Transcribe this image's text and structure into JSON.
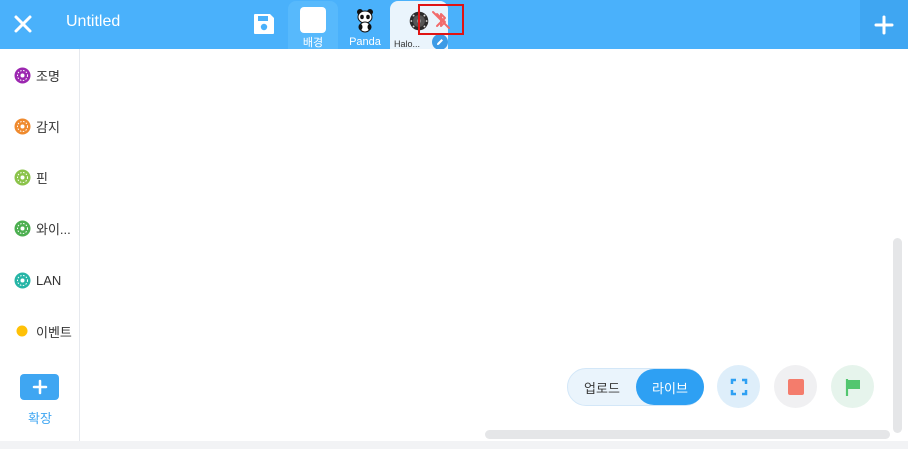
{
  "header": {
    "title": "Untitled",
    "tabs": [
      {
        "label": "배경"
      },
      {
        "label": "Panda"
      },
      {
        "label": "Halo..."
      }
    ]
  },
  "sidebar": {
    "categories": [
      {
        "label": "조명",
        "color": "#9c27b0"
      },
      {
        "label": "감지",
        "color": "#ef8a2e"
      },
      {
        "label": "핀",
        "color": "#8bc34a"
      },
      {
        "label": "와이...",
        "color": "#4caf50"
      },
      {
        "label": "LAN",
        "color": "#26b5a6"
      },
      {
        "label": "이벤트",
        "color": "#ffc107"
      }
    ],
    "extension_label": "확장"
  },
  "controls": {
    "upload_label": "업로드",
    "live_label": "라이브"
  },
  "colors": {
    "header": "#4ab1fb",
    "accent": "#2ea0f3",
    "bluetooth_off": "#f26b6b",
    "stop": "#f47c6c",
    "flag": "#52c66f",
    "highlight_box": "#e01313"
  },
  "icons": {
    "close": "close-icon",
    "save": "save-icon",
    "bluetooth": "bluetooth-disconnected-icon",
    "add": "plus-icon",
    "edit": "pencil-icon",
    "fullscreen": "fullscreen-icon",
    "stop": "stop-icon",
    "flag": "green-flag-icon"
  }
}
